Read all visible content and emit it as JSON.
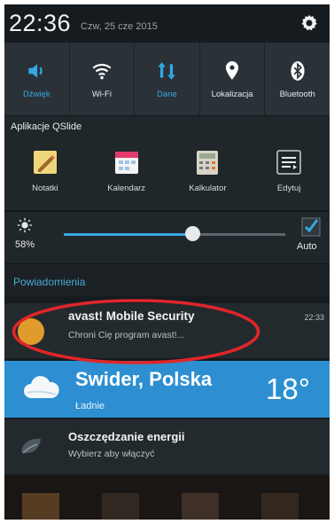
{
  "status": {
    "time": "22:36",
    "date": "Czw, 25 cze 2015",
    "settings_icon": "gear-icon"
  },
  "quick_settings": [
    {
      "label": "Dźwięk",
      "icon": "speaker-icon",
      "color": "#34a8e6"
    },
    {
      "label": "Wi-Fi",
      "icon": "wifi-icon",
      "color": "#ffffff"
    },
    {
      "label": "Dane",
      "icon": "data-transfer-icon",
      "color": "#34a8e6"
    },
    {
      "label": "Lokalizacja",
      "icon": "location-pin-icon",
      "color": "#ffffff"
    },
    {
      "label": "Bluetooth",
      "icon": "bluetooth-icon",
      "color": "#ffffff"
    }
  ],
  "qslide": {
    "title": "Aplikacje QSlide",
    "apps": [
      {
        "label": "Notatki",
        "icon": "notepad-icon"
      },
      {
        "label": "Kalendarz",
        "icon": "calendar-icon"
      },
      {
        "label": "Kalkulator",
        "icon": "calculator-icon"
      },
      {
        "label": "Edytuj",
        "icon": "edit-list-icon"
      }
    ]
  },
  "brightness": {
    "percent_label": "58%",
    "value": 0.58,
    "auto_label": "Auto",
    "auto_checked": true
  },
  "notifications": {
    "header": "Powiadomienia",
    "items": [
      {
        "title": "avast! Mobile Security",
        "subtitle": "Chroni Cię program avast!...",
        "time": "22:33",
        "icon": "avast-icon"
      }
    ]
  },
  "weather": {
    "location": "Swider, Polska",
    "condition": "Ładnie",
    "temperature": "18°",
    "icon": "cloud-icon"
  },
  "energy": {
    "title": "Oszczędzanie energii",
    "subtitle": "Wybierz aby włączyć",
    "icon": "leaf-icon"
  },
  "colors": {
    "accent": "#34a8e6",
    "weather_bg": "#2d8fd1",
    "highlight_circle": "#e0262a"
  }
}
